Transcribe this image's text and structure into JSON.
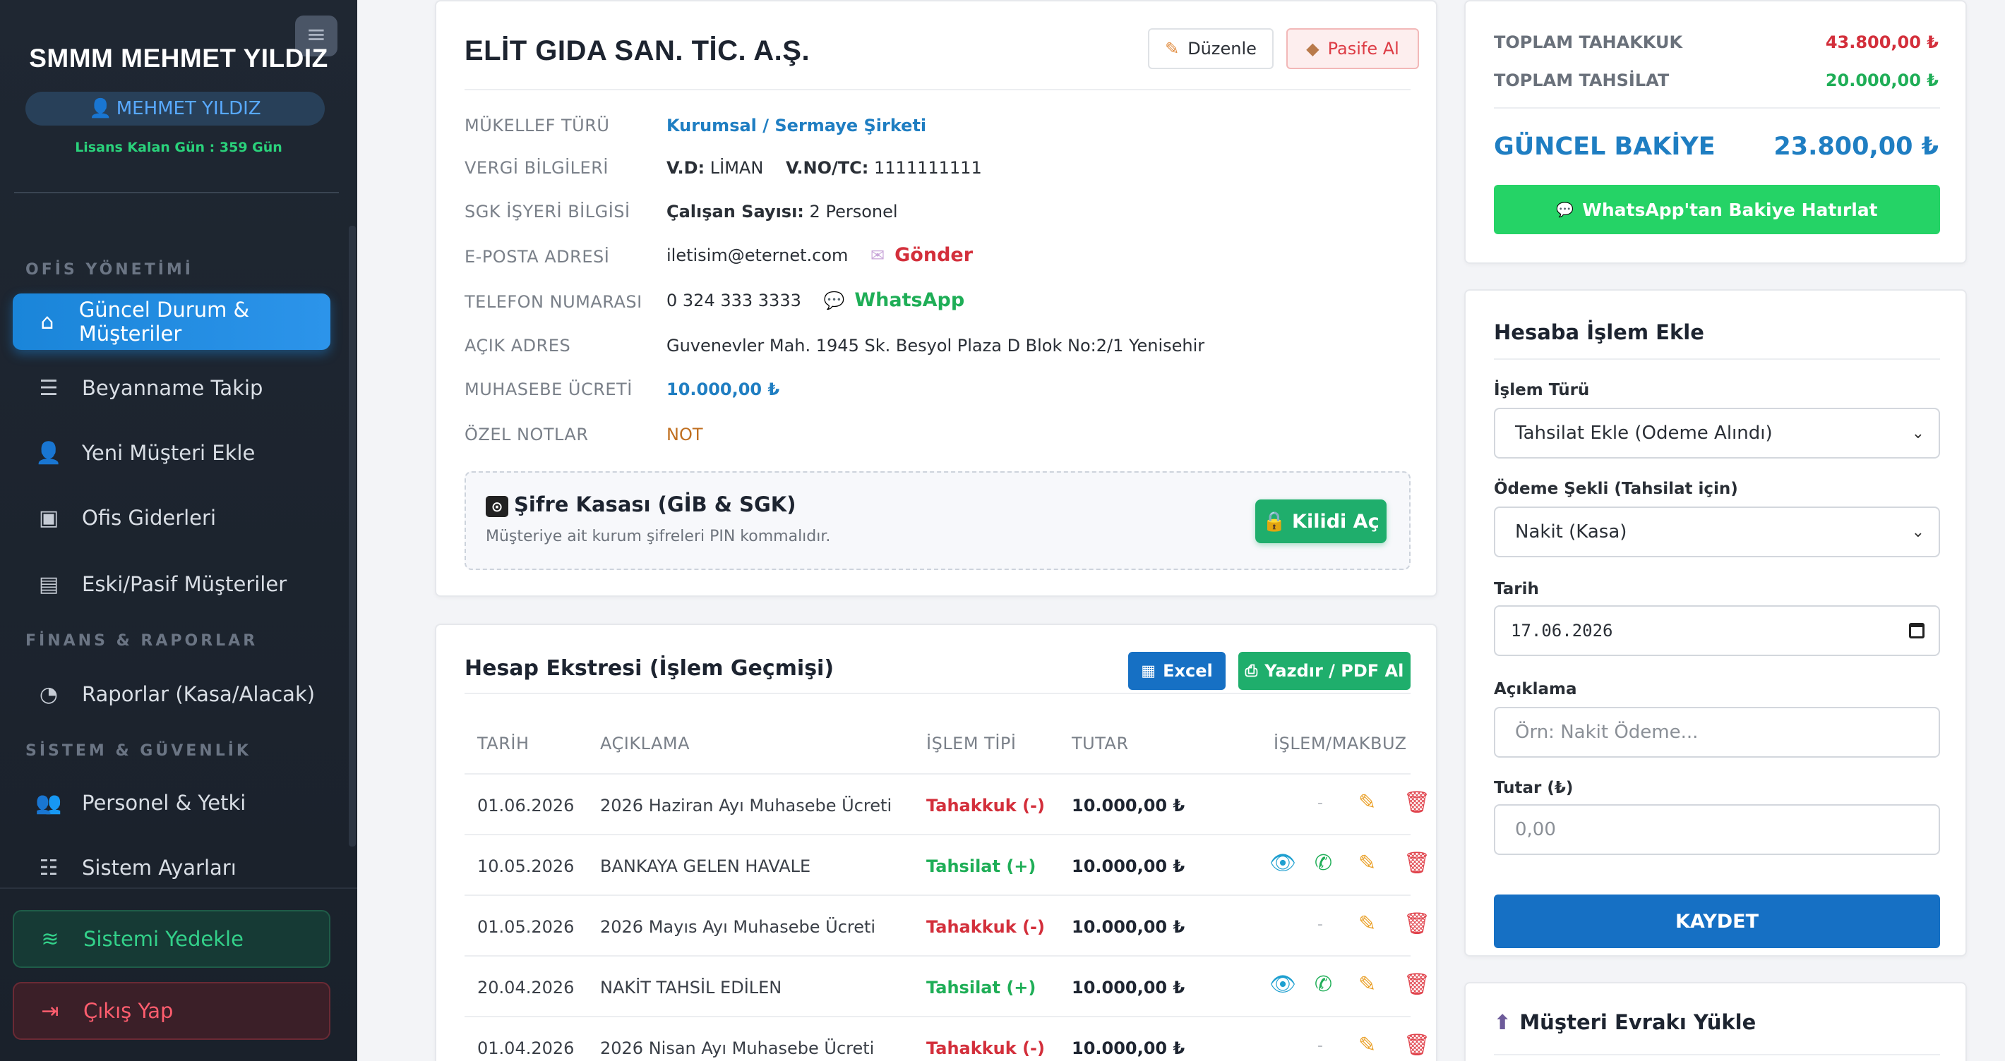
{
  "sidebar": {
    "brand": "SMMM MEHMET YILDIZ",
    "user": "MEHMET YILDIZ",
    "license": "Lisans Kalan Gün : 359 Gün",
    "sections": {
      "office": "OFİS YÖNETİMİ",
      "finance": "FİNANS & RAPORLAR",
      "system": "SİSTEM & GÜVENLİK"
    },
    "items": [
      {
        "label": "Güncel Durum & Müşteriler",
        "icon": "home-icon"
      },
      {
        "label": "Beyanname Takip",
        "icon": "list-check-icon"
      },
      {
        "label": "Yeni Müşteri Ekle",
        "icon": "user-plus-icon"
      },
      {
        "label": "Ofis Giderleri",
        "icon": "money-icon"
      },
      {
        "label": "Eski/Pasif Müşteriler",
        "icon": "archive-icon"
      },
      {
        "label": "Raporlar (Kasa/Alacak)",
        "icon": "pie-chart-icon"
      },
      {
        "label": "Personel & Yetki",
        "icon": "users-icon"
      },
      {
        "label": "Sistem Ayarları",
        "icon": "sliders-icon"
      }
    ],
    "backup": "Sistemi Yedekle",
    "logout": "Çıkış Yap"
  },
  "client": {
    "name": "ELİT GIDA SAN. TİC. A.Ş.",
    "edit_label": "Düzenle",
    "passive_label": "Pasife Al",
    "fields": {
      "type_label": "MÜKELLEF TÜRÜ",
      "type_value": "Kurumsal / Sermaye Şirketi",
      "tax_label": "VERGİ BİLGİLERİ",
      "tax_office_key": "V.D:",
      "tax_office": "LİMAN",
      "tax_no_key": "V.NO/TC:",
      "tax_no": "1111111111",
      "sgk_label": "SGK İŞYERİ BİLGİSİ",
      "sgk_key": "Çalışan Sayısı:",
      "sgk_value": "2 Personel",
      "email_label": "E-POSTA ADRESİ",
      "email_value": "iletisim@eternet.com",
      "email_action": "Gönder",
      "phone_label": "TELEFON NUMARASI",
      "phone_value": "0 324 333 3333",
      "phone_action": "WhatsApp",
      "address_label": "AÇIK ADRES",
      "address_value": "Guvenevler Mah. 1945 Sk. Besyol Plaza D Blok No:2/1 Yenisehir",
      "fee_label": "MUHASEBE ÜCRETİ",
      "fee_value": "10.000,00 ₺",
      "notes_label": "ÖZEL NOTLAR",
      "notes_value": "NOT"
    },
    "vault": {
      "title": "Şifre Kasası (GİB & SGK)",
      "subtitle": "Müşteriye ait kurum şifreleri PIN kommalıdır.",
      "unlock_label": "Kilidi Aç"
    }
  },
  "statement": {
    "title": "Hesap Ekstresi (İşlem Geçmişi)",
    "excel_label": "Excel",
    "pdf_label": "Yazdır / PDF Al",
    "columns": [
      "TARİH",
      "AÇIKLAMA",
      "İŞLEM TİPİ",
      "TUTAR",
      "İŞLEM/MAKBUZ"
    ],
    "rows": [
      {
        "date": "01.06.2026",
        "desc": "2026 Haziran Ayı Muhasebe Ücreti",
        "type": "Tahakkuk (-)",
        "kind": "debit",
        "amount": "10.000,00 ₺"
      },
      {
        "date": "10.05.2026",
        "desc": "BANKAYA GELEN HAVALE",
        "type": "Tahsilat (+)",
        "kind": "credit",
        "amount": "10.000,00 ₺"
      },
      {
        "date": "01.05.2026",
        "desc": "2026 Mayıs Ayı Muhasebe Ücreti",
        "type": "Tahakkuk (-)",
        "kind": "debit",
        "amount": "10.000,00 ₺"
      },
      {
        "date": "20.04.2026",
        "desc": "NAKİT TAHSİL EDİLEN",
        "type": "Tahsilat (+)",
        "kind": "credit",
        "amount": "10.000,00 ₺"
      },
      {
        "date": "01.04.2026",
        "desc": "2026 Nisan Ayı Muhasebe Ücreti",
        "type": "Tahakkuk (-)",
        "kind": "debit",
        "amount": "10.000,00 ₺"
      }
    ]
  },
  "summary": {
    "accrual_label": "TOPLAM TAHAKKUK",
    "accrual_value": "43.800,00 ₺",
    "collection_label": "TOPLAM TAHSİLAT",
    "collection_value": "20.000,00 ₺",
    "balance_label": "GÜNCEL BAKİYE",
    "balance_value": "23.800,00 ₺",
    "whatsapp_label": "WhatsApp'tan Bakiye Hatırlat"
  },
  "form": {
    "title": "Hesaba İşlem Ekle",
    "type_label": "İşlem Türü",
    "type_value": "Tahsilat Ekle (Odeme Alındı)",
    "method_label": "Ödeme Şekli (Tahsilat için)",
    "method_value": "Nakit (Kasa)",
    "date_label": "Tarih",
    "date_value": "17.06.2026",
    "desc_label": "Açıklama",
    "desc_placeholder": "Örn: Nakit Ödeme...",
    "amount_label": "Tutar (₺)",
    "amount_placeholder": "0,00",
    "save_label": "KAYDET"
  },
  "upload": {
    "title": "Müşteri Evrakı Yükle"
  },
  "colors": {
    "accent": "#1f7ec2",
    "success": "#1fae6c",
    "danger": "#d32f3b",
    "sidebar": "#1f2732"
  }
}
